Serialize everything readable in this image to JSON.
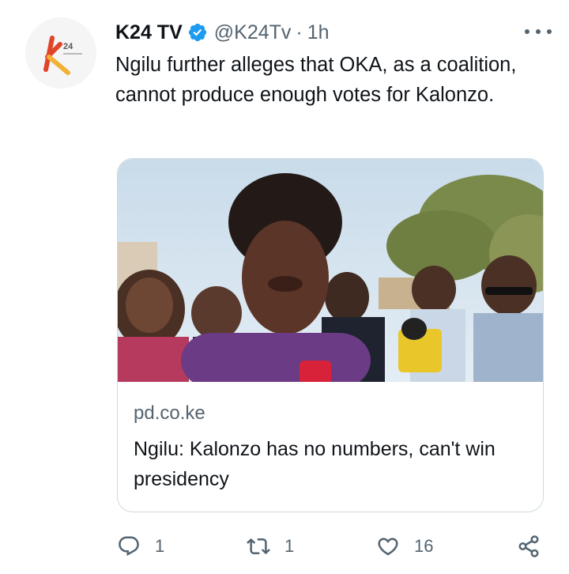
{
  "tweet": {
    "display_name": "K24 TV",
    "verified": true,
    "handle": "@K24Tv",
    "separator": "·",
    "time": "1h",
    "text": "Ngilu further alleges that OKA, as a coalition, cannot produce enough votes for Kalonzo.",
    "avatar_logo_text": "24"
  },
  "card": {
    "domain": "pd.co.ke",
    "title": "Ngilu: Kalonzo has no numbers, can't win presidency"
  },
  "actions": {
    "reply_count": "1",
    "retweet_count": "1",
    "like_count": "16"
  },
  "icons": {
    "verified": "verified-badge-icon",
    "more": "more-options-icon",
    "reply": "reply-icon",
    "retweet": "retweet-icon",
    "like": "heart-icon",
    "share": "share-icon"
  },
  "colors": {
    "verified": "#1d9bf0",
    "secondary_text": "#536471",
    "primary_text": "#0f1419",
    "card_border": "#cfd9de"
  }
}
